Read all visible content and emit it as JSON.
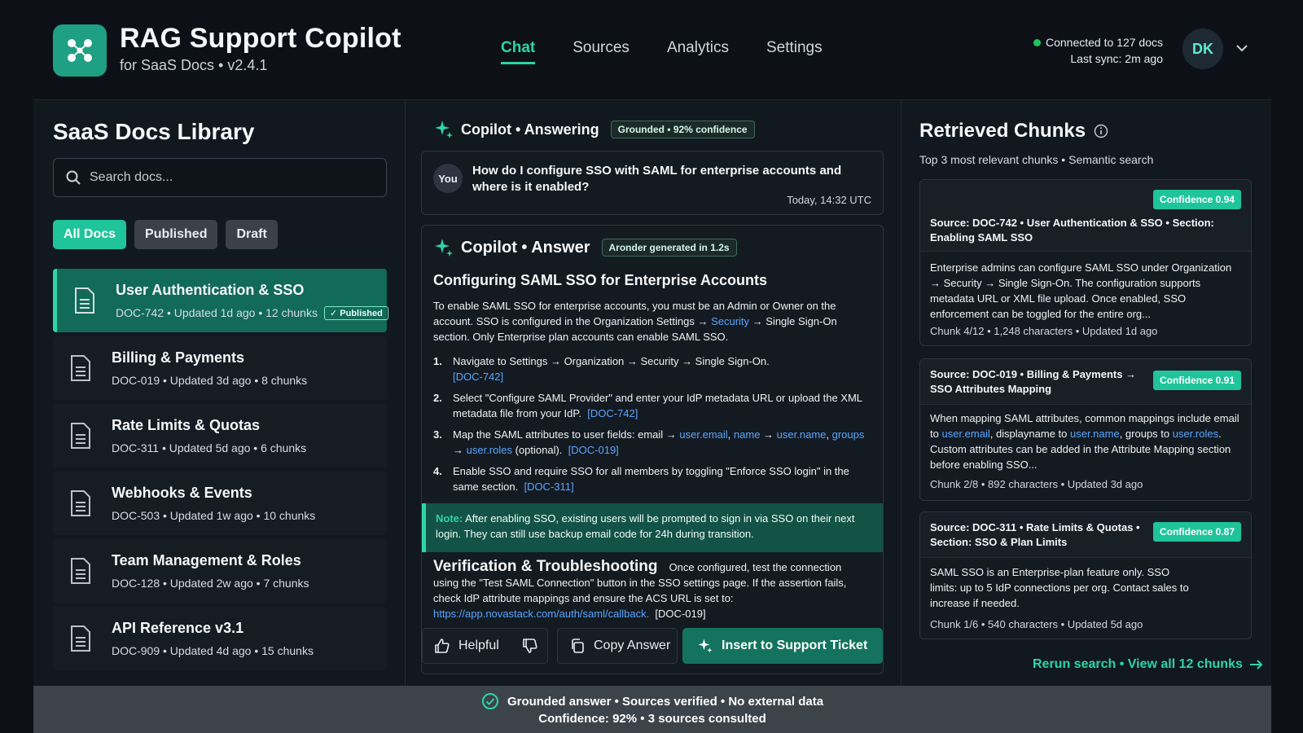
{
  "header": {
    "title": "RAG Support Copilot",
    "subtitle": "for SaaS Docs • v2.4.1",
    "nav": [
      "Chat",
      "Sources",
      "Analytics",
      "Settings"
    ],
    "connection": "Connected to 127 docs",
    "last_sync": "Last sync: 2m ago",
    "avatar": "DK"
  },
  "library": {
    "title": "SaaS Docs Library",
    "search_placeholder": "Search docs...",
    "filters": [
      "All Docs",
      "Published",
      "Draft"
    ],
    "docs": [
      {
        "title": "User Authentication & SSO",
        "meta": "DOC-742 • Updated 1d ago • 12 chunks",
        "badge": "Published"
      },
      {
        "title": "Billing & Payments",
        "meta": "DOC-019 • Updated 3d ago • 8 chunks"
      },
      {
        "title": "Rate Limits & Quotas",
        "meta": "DOC-311 • Updated 5d ago • 6 chunks"
      },
      {
        "title": "Webhooks & Events",
        "meta": "DOC-503 • Updated 1w ago • 10 chunks"
      },
      {
        "title": "Team Management & Roles",
        "meta": "DOC-128 • Updated 2w ago • 7 chunks"
      },
      {
        "title": "API Reference v3.1",
        "meta": "DOC-909 • Updated 4d ago • 15 chunks"
      }
    ]
  },
  "chat": {
    "status_title": "Copilot • Answering",
    "status_chip": "Grounded • 92% confidence",
    "question": {
      "avatar": "You",
      "text": "How do I configure SSO with SAML for enterprise accounts and where is it enabled?",
      "time": "Today, 14:32 UTC"
    },
    "answer": {
      "title": "Copilot • Answer",
      "chip": "Aronder generated in 1.2s",
      "heading": "Configuring SAML SSO for Enterprise Accounts",
      "intro_1": "To enable SAML SSO for enterprise accounts, you must be an Admin or Owner on the account. SSO is configured in the Organization Settings → ",
      "intro_link": "Security",
      "intro_2": " → Single Sign-On section. Only Enterprise plan accounts can enable SAML SSO.",
      "steps": [
        {
          "num": "1.",
          "text": "Navigate to Settings → Organization → Security → Single Sign-On.",
          "ref": "[DOC-742]"
        },
        {
          "num": "2.",
          "text": "Select \"Configure SAML Provider\" and enter your IdP metadata URL or upload the XML metadata file from your IdP.",
          "ref": "[DOC-742]"
        },
        {
          "num": "3.",
          "text_a": "Map the SAML attributes to user fields: email → ",
          "l1": "user.email",
          "t2": ", ",
          "l2": "name",
          "t3": " → ",
          "l3": "user.name",
          "t4": ", ",
          "l4": "groups",
          "t5": " → ",
          "l5": "user.roles",
          "t6": " (optional).",
          "ref": "[DOC-019]"
        },
        {
          "num": "4.",
          "text": "Enable SSO and require SSO for all members by toggling \"Enforce SSO login\" in the same section.",
          "ref": "[DOC-311]"
        }
      ],
      "note_label": "Note:",
      "note_text": "After enabling SSO, existing users will be prompted to sign in via SSO on their next login. They can still use backup email code for 24h during transition.",
      "verify_title": "Verification & Troubleshooting",
      "verify_text": "Once configured, test the connection using the \"Test SAML Connection\" button in the SSO settings page. If the assertion fails, check IdP attribute mappings and ensure the ACS URL is set to:",
      "verify_url": "https://app.novastack.com/auth/saml/callback.",
      "verify_ref": "[DOC-019]",
      "btn_helpful": "Helpful",
      "btn_copy": "Copy Answer",
      "btn_insert": "Insert to Support Ticket"
    }
  },
  "chunks": {
    "title": "Retrieved Chunks",
    "subtitle": "Top 3 most relevant chunks • Semantic search",
    "items": [
      {
        "confidence": "Confidence 0.94",
        "source": "Source: DOC-742 • User Authentication & SSO • Section: Enabling SAML SSO",
        "body_a": "Enterprise admins can configure SAML SSO under Organization → ",
        "body_link": "Security",
        "body_b": " → Single Sign-On. The configuration supports metadata URL or XML file upload. Once enabled, SSO enforcement can be toggled for the entire org...",
        "meta": "Chunk 4/12 • 1,248 characters • Updated 1d ago"
      },
      {
        "confidence": "Confidence 0.91",
        "source": "Source: DOC-019 • Billing & Payments → SSO Attributes Mapping",
        "body_a": "When mapping SAML attributes, common mappings include email to ",
        "l1": "user.email",
        "t2": ", displayname to ",
        "l2": "user.name",
        "t3": ", groups to ",
        "l3": "user.roles",
        "t4": ". Custom attributes can be added in the Attribute Mapping section before enabling SSO...",
        "meta": "Chunk 2/8 • 892 characters • Updated 3d ago"
      },
      {
        "confidence": "Confidence 0.87",
        "source": "Source: DOC-311 • Rate Limits & Quotas • Section: SSO & Plan Limits",
        "body_a": "SAML SSO is an Enterprise-plan feature only. SSO limits: up to 5 IdP connections per org. Contact sales to increase if needed.",
        "meta": "Chunk 1/6 • 540 characters • Updated 5d ago"
      }
    ],
    "rerun": "Rerun search • View all 12 chunks"
  },
  "footer": {
    "line1": "Grounded answer • Sources verified • No external data",
    "line2": "Confidence: 92% • 3 sources consulted"
  },
  "colors": {
    "accent": "#2dd4a8",
    "accent_dark": "#14735f",
    "link": "#58a6ff",
    "background": "#0d1117"
  }
}
